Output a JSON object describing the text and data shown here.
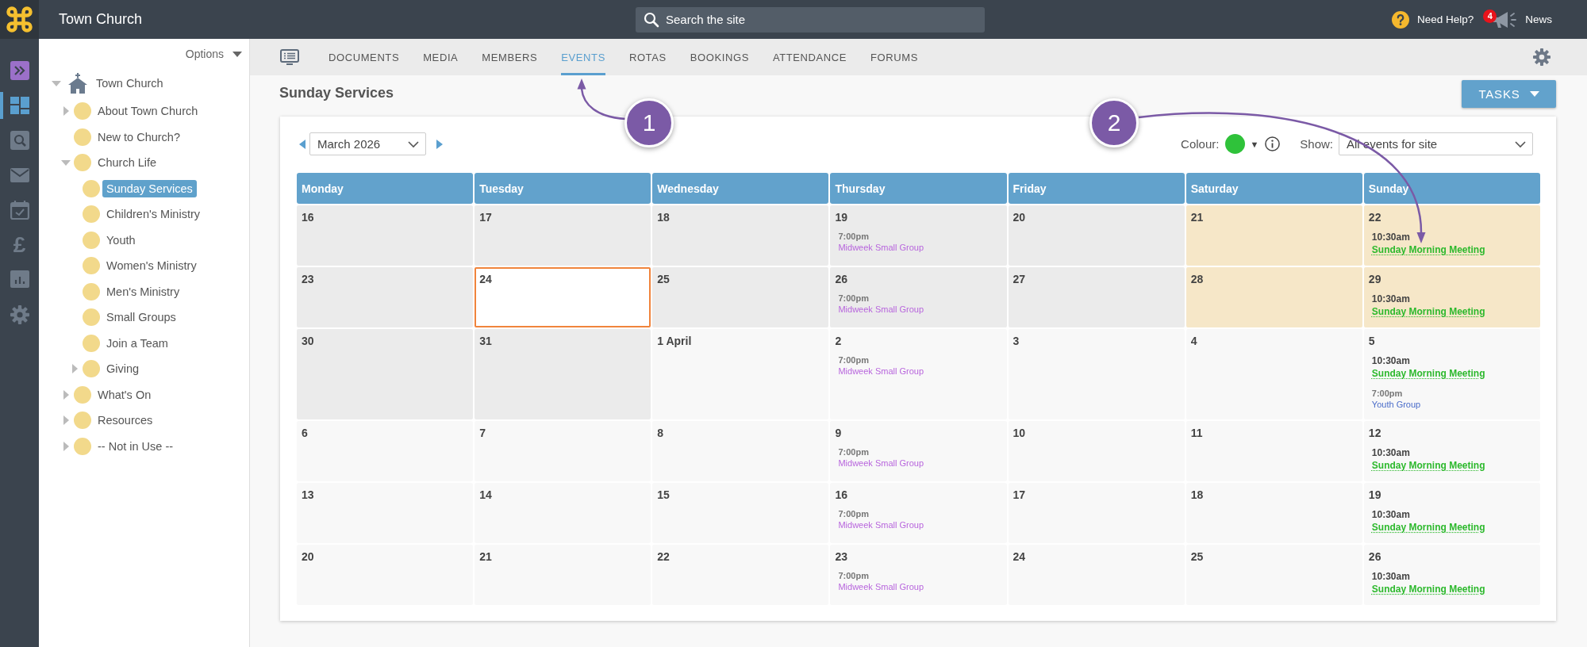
{
  "topbar": {
    "site_title": "Town Church",
    "search": {
      "placeholder": "Search the site"
    },
    "help": {
      "label": "Need Help?"
    },
    "news": {
      "badge": "4",
      "label": "News"
    }
  },
  "rail": [
    {
      "selected": false
    },
    {
      "selected": true
    },
    {
      "selected": false
    },
    {
      "selected": false
    },
    {
      "selected": false
    },
    {
      "selected": false,
      "glyph": "£"
    },
    {
      "selected": false
    },
    {
      "selected": false
    }
  ],
  "sidebar": {
    "options": "Options",
    "tree": [
      {
        "label": "Town Church",
        "kind": "site",
        "expanded": true,
        "selected": false,
        "children": [
          {
            "label": "About Town Church",
            "kind": "page",
            "expanded": false,
            "selected": false
          },
          {
            "label": "New to Church?",
            "kind": "page",
            "selected": false
          },
          {
            "label": "Church Life",
            "kind": "page",
            "expanded": true,
            "selected": false,
            "children": [
              {
                "label": "Sunday Services",
                "kind": "page",
                "selected": true
              },
              {
                "label": "Children's Ministry",
                "kind": "page",
                "selected": false
              },
              {
                "label": "Youth",
                "kind": "page",
                "selected": false
              },
              {
                "label": "Women's Ministry",
                "kind": "page",
                "selected": false
              },
              {
                "label": "Men's Ministry",
                "kind": "page",
                "selected": false
              },
              {
                "label": "Small Groups",
                "kind": "page",
                "selected": false
              },
              {
                "label": "Join a Team",
                "kind": "page",
                "selected": false
              },
              {
                "label": "Giving",
                "kind": "page",
                "expanded": false,
                "selected": false
              }
            ]
          },
          {
            "label": "What's On",
            "kind": "page",
            "expanded": false,
            "selected": false
          },
          {
            "label": "Resources",
            "kind": "page",
            "expanded": false,
            "selected": false
          },
          {
            "label": "-- Not in Use --",
            "kind": "page",
            "expanded": false,
            "selected": false
          }
        ]
      }
    ]
  },
  "nav_tabs": [
    {
      "label": "DOCUMENTS",
      "selected": false
    },
    {
      "label": "MEDIA",
      "selected": false
    },
    {
      "label": "MEMBERS",
      "selected": false
    },
    {
      "label": "EVENTS",
      "selected": true
    },
    {
      "label": "ROTAS",
      "selected": false
    },
    {
      "label": "BOOKINGS",
      "selected": false
    },
    {
      "label": "ATTENDANCE",
      "selected": false
    },
    {
      "label": "FORUMS",
      "selected": false
    }
  ],
  "page_title": "Sunday Services",
  "tasks_button": "TASKS",
  "toolbar": {
    "month": "March 2026",
    "colour": {
      "label": "Colour:",
      "color": "#2fc23a",
      "caret": "▼"
    },
    "show": {
      "label": "Show:",
      "value": "All events for site"
    }
  },
  "calendar": {
    "columns": [
      "Monday",
      "Tuesday",
      "Wednesday",
      "Thursday",
      "Friday",
      "Saturday",
      "Sunday"
    ],
    "weeks": [
      [
        {
          "day": "16",
          "kind": "month"
        },
        {
          "day": "17",
          "kind": "month"
        },
        {
          "day": "18",
          "kind": "month"
        },
        {
          "day": "19",
          "kind": "month",
          "events": [
            {
              "time": "7:00pm",
              "title": "Midweek Small Group",
              "color": "#b866dd",
              "highlighted": false
            }
          ]
        },
        {
          "day": "20",
          "kind": "month"
        },
        {
          "day": "21",
          "kind": "weekend"
        },
        {
          "day": "22",
          "kind": "weekend",
          "events": [
            {
              "time": "10:30am",
              "title": "Sunday Morning Meeting",
              "color": "#2db92d",
              "highlighted": true
            }
          ]
        }
      ],
      [
        {
          "day": "23",
          "kind": "month"
        },
        {
          "day": "24",
          "kind": "today"
        },
        {
          "day": "25",
          "kind": "month"
        },
        {
          "day": "26",
          "kind": "month",
          "events": [
            {
              "time": "7:00pm",
              "title": "Midweek Small Group",
              "color": "#b866dd",
              "highlighted": false
            }
          ]
        },
        {
          "day": "27",
          "kind": "month"
        },
        {
          "day": "28",
          "kind": "weekend"
        },
        {
          "day": "29",
          "kind": "weekend",
          "events": [
            {
              "time": "10:30am",
              "title": "Sunday Morning Meeting",
              "color": "#2db92d",
              "highlighted": true
            }
          ]
        }
      ],
      [
        {
          "day": "30",
          "kind": "month"
        },
        {
          "day": "31",
          "kind": "month"
        },
        {
          "day": "1 April",
          "kind": "other"
        },
        {
          "day": "2",
          "kind": "other",
          "events": [
            {
              "time": "7:00pm",
              "title": "Midweek Small Group",
              "color": "#b866dd",
              "highlighted": false
            }
          ]
        },
        {
          "day": "3",
          "kind": "other"
        },
        {
          "day": "4",
          "kind": "other"
        },
        {
          "day": "5",
          "kind": "other",
          "events": [
            {
              "time": "10:30am",
              "title": "Sunday Morning Meeting",
              "color": "#2db92d",
              "highlighted": true
            },
            {
              "time": "7:00pm",
              "title": "Youth Group",
              "color": "#4a6cc9",
              "highlighted": false
            }
          ]
        }
      ],
      [
        {
          "day": "6",
          "kind": "other"
        },
        {
          "day": "7",
          "kind": "other"
        },
        {
          "day": "8",
          "kind": "other"
        },
        {
          "day": "9",
          "kind": "other",
          "events": [
            {
              "time": "7:00pm",
              "title": "Midweek Small Group",
              "color": "#b866dd",
              "highlighted": false
            }
          ]
        },
        {
          "day": "10",
          "kind": "other"
        },
        {
          "day": "11",
          "kind": "other"
        },
        {
          "day": "12",
          "kind": "other",
          "events": [
            {
              "time": "10:30am",
              "title": "Sunday Morning Meeting",
              "color": "#2db92d",
              "highlighted": true
            }
          ]
        }
      ],
      [
        {
          "day": "13",
          "kind": "other"
        },
        {
          "day": "14",
          "kind": "other"
        },
        {
          "day": "15",
          "kind": "other"
        },
        {
          "day": "16",
          "kind": "other",
          "events": [
            {
              "time": "7:00pm",
              "title": "Midweek Small Group",
              "color": "#b866dd",
              "highlighted": false
            }
          ]
        },
        {
          "day": "17",
          "kind": "other"
        },
        {
          "day": "18",
          "kind": "other"
        },
        {
          "day": "19",
          "kind": "other",
          "events": [
            {
              "time": "10:30am",
              "title": "Sunday Morning Meeting",
              "color": "#2db92d",
              "highlighted": true
            }
          ]
        }
      ],
      [
        {
          "day": "20",
          "kind": "other"
        },
        {
          "day": "21",
          "kind": "other"
        },
        {
          "day": "22",
          "kind": "other"
        },
        {
          "day": "23",
          "kind": "other",
          "events": [
            {
              "time": "7:00pm",
              "title": "Midweek Small Group",
              "color": "#b866dd",
              "highlighted": false
            }
          ]
        },
        {
          "day": "24",
          "kind": "other"
        },
        {
          "day": "25",
          "kind": "other"
        },
        {
          "day": "26",
          "kind": "other",
          "events": [
            {
              "time": "10:30am",
              "title": "Sunday Morning Meeting",
              "color": "#2db92d",
              "highlighted": true
            }
          ]
        }
      ]
    ]
  },
  "callouts": [
    {
      "label": "1"
    },
    {
      "label": "2"
    }
  ]
}
